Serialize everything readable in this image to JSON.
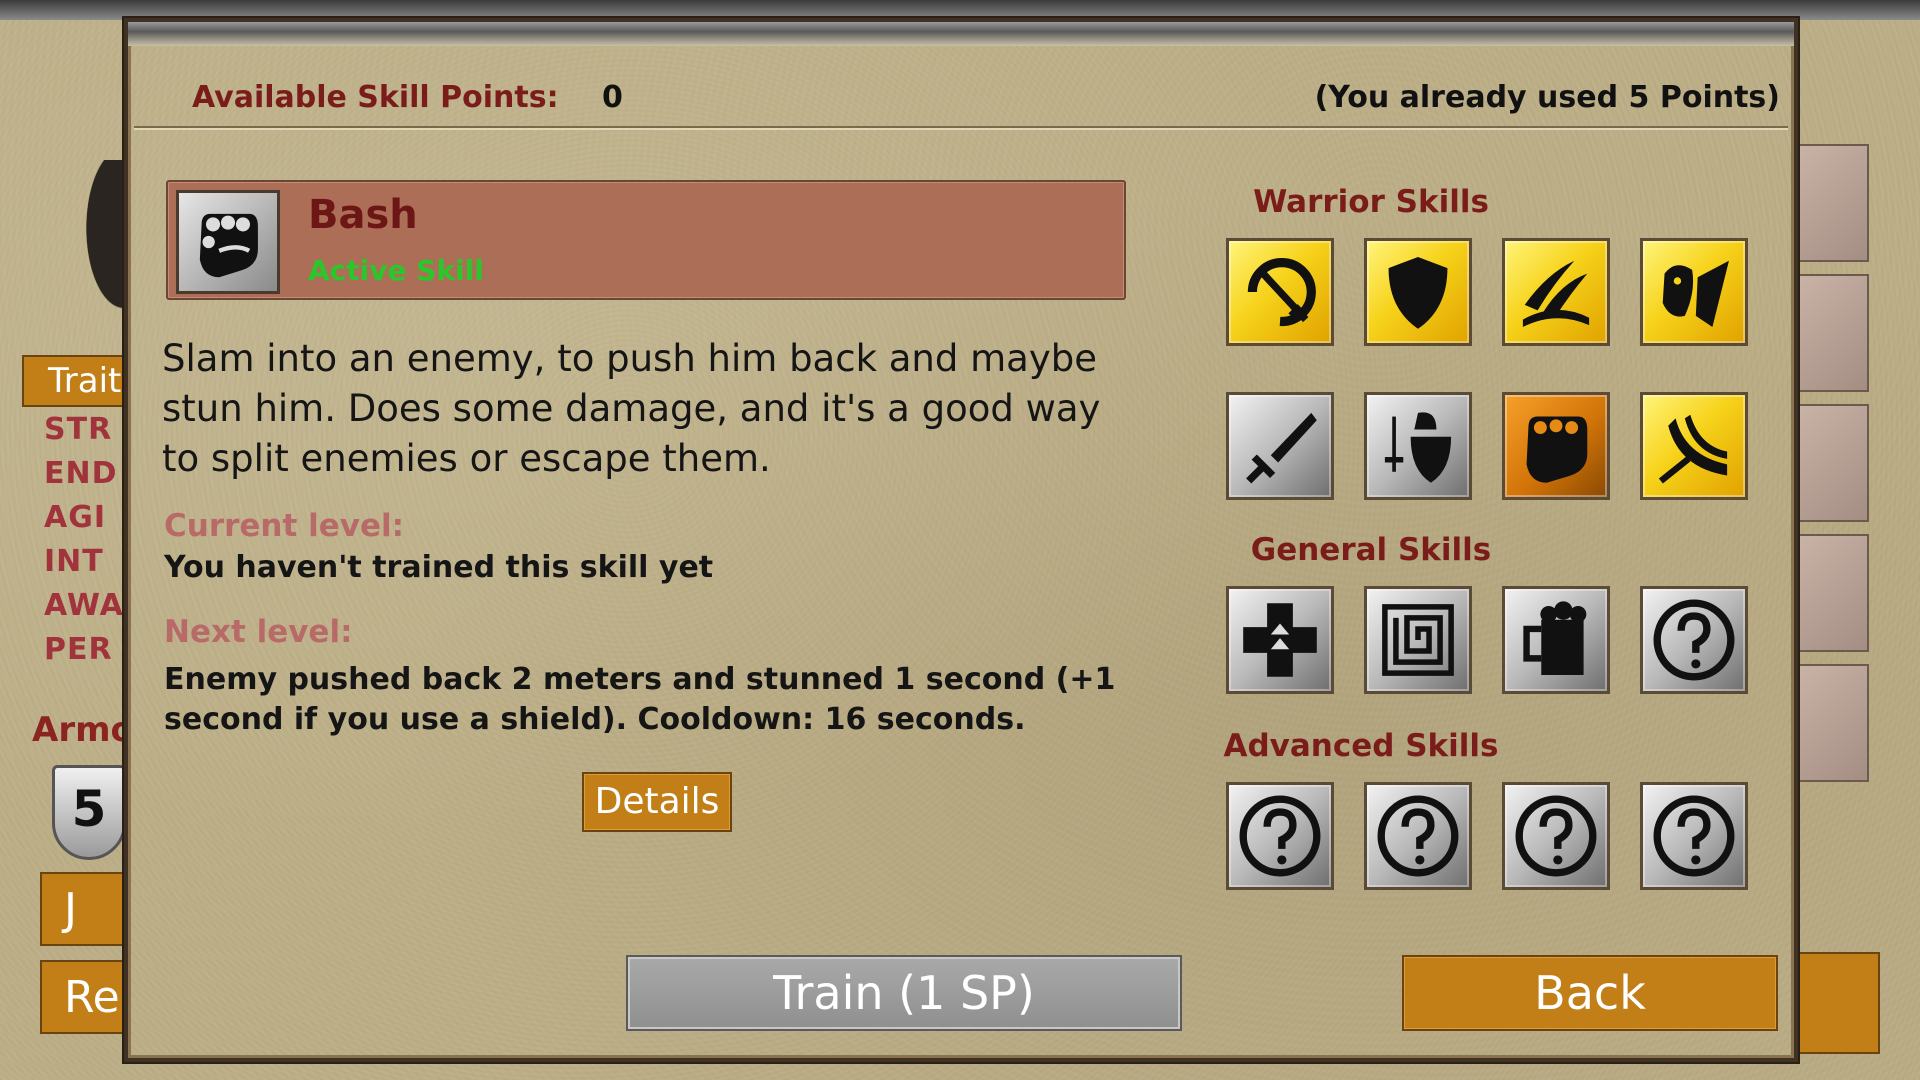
{
  "background": {
    "tab_label": "Traits",
    "stats": [
      "STR",
      "END",
      "AGI",
      "INT",
      "AWA",
      "PER"
    ],
    "armor_label": "Armor",
    "armor_value": "5",
    "button_1_label": "J",
    "button_2_label": "Re"
  },
  "dialog": {
    "skill_points_label": "Available Skill Points:",
    "skill_points_value": "0",
    "used_points_text": "(You already used 5 Points)"
  },
  "selected_skill": {
    "icon": "fist-icon",
    "name": "Bash",
    "type": "Active Skill",
    "description": "Slam into an enemy, to push him back and maybe stun him. Does some damage, and it's a good way to split enemies or escape them.",
    "current_level_label": "Current level:",
    "current_level_text": "You haven't trained this skill yet",
    "next_level_label": "Next level:",
    "next_level_text": "Enemy pushed back 2 meters and stunned 1 second (+1 second if you use a shield). Cooldown: 16 seconds.",
    "details_label": "Details"
  },
  "skill_tree": {
    "warrior_title": "Warrior Skills",
    "general_title": "General Skills",
    "advanced_title": "Advanced Skills",
    "warrior": [
      {
        "icon": "sword-swing-icon",
        "state": "trained"
      },
      {
        "icon": "shield-icon",
        "state": "trained"
      },
      {
        "icon": "slash-icon",
        "state": "trained"
      },
      {
        "icon": "warcry-icon",
        "state": "trained"
      },
      {
        "icon": "broken-sword-icon",
        "state": "locked"
      },
      {
        "icon": "knight-sword-shield-icon",
        "state": "locked"
      },
      {
        "icon": "fist-icon",
        "state": "selected"
      },
      {
        "icon": "whirlwind-sword-icon",
        "state": "trained"
      }
    ],
    "general": [
      {
        "icon": "health-cross-icon",
        "state": "locked"
      },
      {
        "icon": "maze-icon",
        "state": "locked"
      },
      {
        "icon": "beer-mug-icon",
        "state": "locked"
      },
      {
        "icon": "question-icon",
        "state": "unknown"
      }
    ],
    "advanced": [
      {
        "icon": "question-icon",
        "state": "unknown"
      },
      {
        "icon": "question-icon",
        "state": "unknown"
      },
      {
        "icon": "question-icon",
        "state": "unknown"
      },
      {
        "icon": "question-icon",
        "state": "unknown"
      }
    ]
  },
  "actions": {
    "train_label": "Train (1 SP)",
    "back_label": "Back"
  },
  "colors": {
    "title_red": "#7a1d1a",
    "active_green": "#2ac72a",
    "button_orange": "#c27f17",
    "train_gray": "#9d9d9d",
    "card_brown": "#ad6e58",
    "parchment": "#bcae86"
  }
}
